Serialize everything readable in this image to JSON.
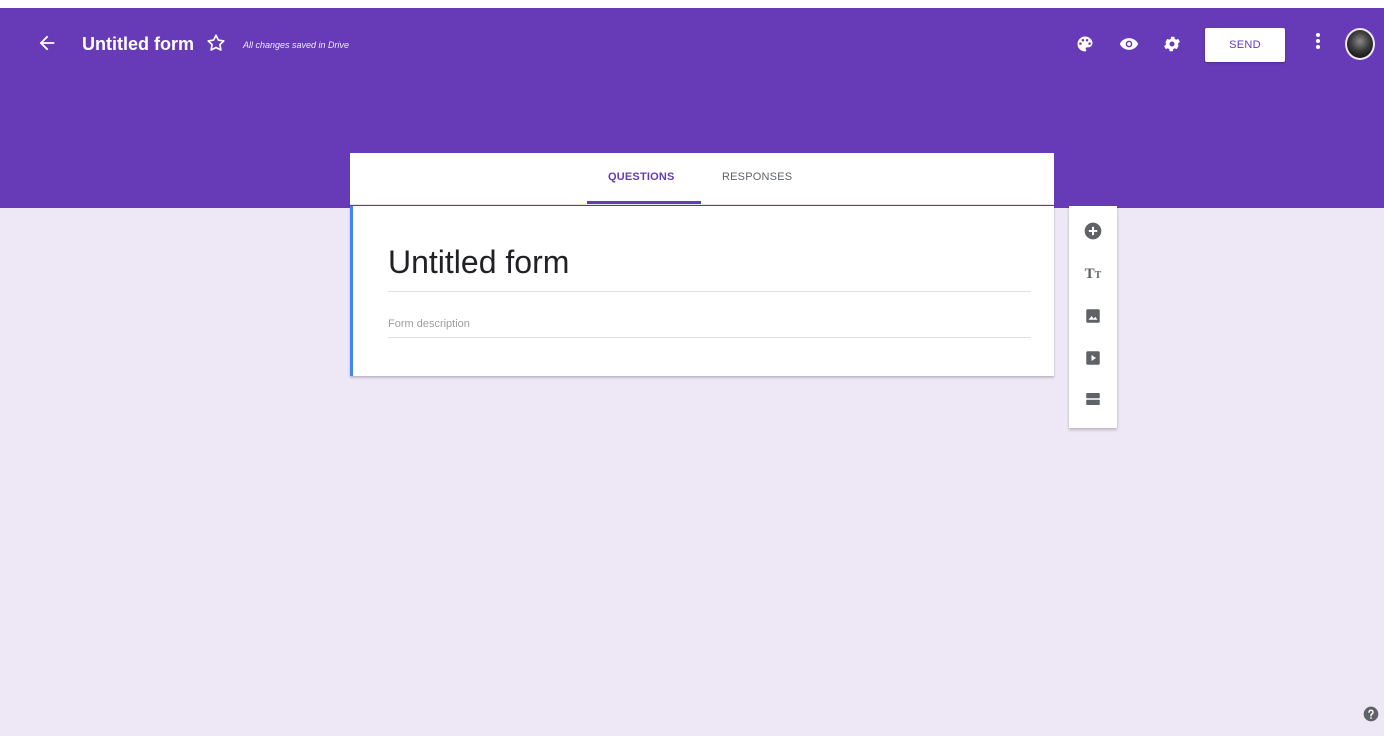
{
  "toolbar": {
    "title": "Untitled form",
    "save_status": "All changes saved in Drive",
    "send_label": "SEND",
    "icons": [
      "back-arrow-icon",
      "star-icon",
      "palette-icon",
      "eye-icon",
      "gear-icon",
      "more-vert-icon",
      "avatar"
    ]
  },
  "tabs": [
    {
      "label": "QUESTIONS",
      "active": true
    },
    {
      "label": "RESPONSES",
      "active": false
    }
  ],
  "form": {
    "title": "Untitled form",
    "description_placeholder": "Form description"
  },
  "side_tools": [
    "add-question-icon",
    "add-title-icon",
    "add-image-icon",
    "add-video-icon",
    "add-section-icon"
  ],
  "colors": {
    "header": "#673ab7",
    "background": "#ede7f6",
    "card_accent": "#4285f4",
    "icon_gray": "#5f6368"
  }
}
